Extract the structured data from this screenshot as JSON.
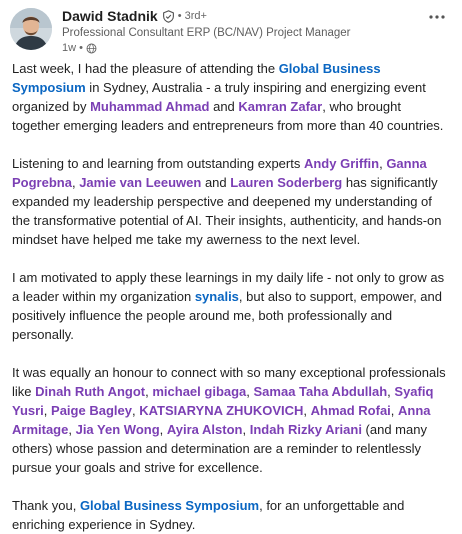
{
  "author": {
    "name": "Dawid Stadnik",
    "degree": "• 3rd+",
    "headline": "Professional Consultant ERP (BC/NAV) Project Manager",
    "time": "1w",
    "time_sep": "•"
  },
  "icons": {
    "more": "more-horizontal-icon",
    "verified": "verified-shield-icon",
    "visibility": "globe-icon"
  },
  "colors": {
    "company_tag": "#0a66c2",
    "person_tag": "#7b3fb4",
    "text": "#1f1f1f",
    "muted": "#666666"
  },
  "post": {
    "p1": [
      {
        "t": "Last week, I had the pleasure of attending the "
      },
      {
        "t": "Global Business Symposium",
        "type": "company"
      },
      {
        "t": " in Sydney, Australia - a truly inspiring and energizing event organized by "
      },
      {
        "t": "Muhammad Ahmad",
        "type": "person"
      },
      {
        "t": " and "
      },
      {
        "t": "Kamran Zafar",
        "type": "person"
      },
      {
        "t": ", who brought together emerging leaders and entrepreneurs from more than 40 countries."
      }
    ],
    "p2": [
      {
        "t": "Listening to and learning from outstanding experts "
      },
      {
        "t": "Andy Griffin",
        "type": "person"
      },
      {
        "t": ", "
      },
      {
        "t": "Ganna Pogrebna",
        "type": "person"
      },
      {
        "t": ", "
      },
      {
        "t": "Jamie van Leeuwen",
        "type": "person"
      },
      {
        "t": " and "
      },
      {
        "t": "Lauren Soderberg",
        "type": "person"
      },
      {
        "t": " has significantly expanded my leadership perspective and deepened my understanding of the transformative potential of AI. Their insights, authenticity, and hands-on mindset have helped me take my awerness to the next level."
      }
    ],
    "p3": [
      {
        "t": "I am motivated to apply these learnings in my daily life - not only to grow as a leader within my organization "
      },
      {
        "t": "synalis",
        "type": "company"
      },
      {
        "t": ", but also to support, empower, and positively influence the people around me, both professionally and personally."
      }
    ],
    "p4": [
      {
        "t": "It was equally an honour to connect with so many exceptional professionals like "
      },
      {
        "t": "Dinah Ruth Angot",
        "type": "person"
      },
      {
        "t": ", "
      },
      {
        "t": "michael gibaga",
        "type": "person"
      },
      {
        "t": ", "
      },
      {
        "t": "Samaa Taha Abdullah",
        "type": "person"
      },
      {
        "t": ", "
      },
      {
        "t": "Syafiq Yusri",
        "type": "person"
      },
      {
        "t": ", "
      },
      {
        "t": "Paige Bagley",
        "type": "person"
      },
      {
        "t": ", "
      },
      {
        "t": "KATSIARYNA ZHUKOVICH",
        "type": "person"
      },
      {
        "t": ", "
      },
      {
        "t": "Ahmad Rofai",
        "type": "person"
      },
      {
        "t": ", "
      },
      {
        "t": "Anna Armitage",
        "type": "person"
      },
      {
        "t": ", "
      },
      {
        "t": "Jia Yen Wong",
        "type": "person"
      },
      {
        "t": ", "
      },
      {
        "t": "Ayira Alston",
        "type": "person"
      },
      {
        "t": ", "
      },
      {
        "t": "Indah Rizky Ariani",
        "type": "person"
      },
      {
        "t": " (and many others) whose passion and determination are a reminder to relentlessly pursue your goals and strive for excellence."
      }
    ],
    "p5": [
      {
        "t": "Thank you, "
      },
      {
        "t": "Global Business Symposium",
        "type": "company"
      },
      {
        "t": ", for an unforgettable and enriching experience in Sydney."
      }
    ]
  }
}
